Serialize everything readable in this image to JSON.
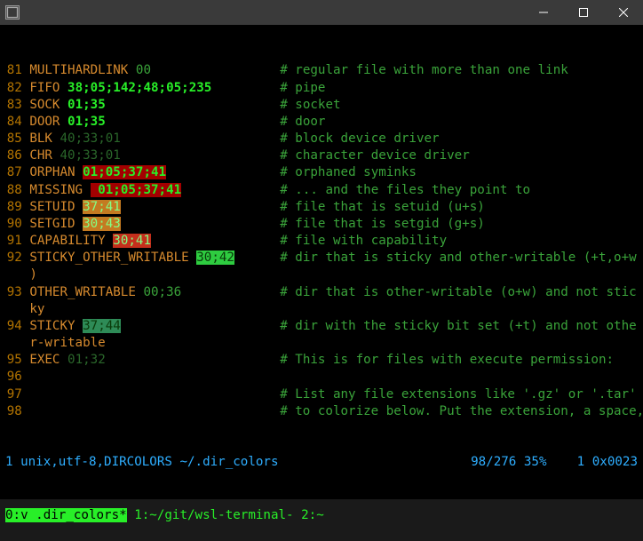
{
  "window": {
    "title": ""
  },
  "lines": [
    {
      "n": "81",
      "key": "MULTIHARDLINK",
      "val": "00",
      "cls": "",
      "c": "# regular file with more than one link"
    },
    {
      "n": "82",
      "key": "FIFO",
      "val": "38;05;142;48;05;235",
      "cls": "key-bold",
      "c": "# pipe"
    },
    {
      "n": "83",
      "key": "SOCK",
      "val": "01;35",
      "cls": "key-bold",
      "c": "# socket"
    },
    {
      "n": "84",
      "key": "DOOR",
      "val": "01;35",
      "cls": "key-bold",
      "c": "# door"
    },
    {
      "n": "85",
      "key": "BLK",
      "val": "40;33;01",
      "cls": "key-dim",
      "c": "# block device driver"
    },
    {
      "n": "86",
      "key": "CHR",
      "val": "40;33;01",
      "cls": "key-dim",
      "c": "# character device driver"
    },
    {
      "n": "87",
      "key": "ORPHAN",
      "val": "01;05;37;41",
      "cls": "hl-red",
      "c": "# orphaned syminks"
    },
    {
      "n": "88",
      "key": "MISSING",
      "val": " 01;05;37;41",
      "cls": "hl-red",
      "c": "# ... and the files they point to"
    },
    {
      "n": "89",
      "key": "SETUID",
      "val": "37;41",
      "cls": "hl-org",
      "c": "# file that is setuid (u+s)"
    },
    {
      "n": "90",
      "key": "SETGID",
      "val": "30;43",
      "cls": "hl-org",
      "c": "# file that is setgid (g+s)"
    },
    {
      "n": "91",
      "key": "CAPABILITY",
      "val": "30;41",
      "cls": "hl-org2",
      "c": "# file with capability"
    },
    {
      "n": "92",
      "key": "STICKY_OTHER_WRITABLE",
      "val": "30;42",
      "cls": "hl-grn",
      "c": "# dir that is sticky and other-writable (+t,o+w",
      "wrap": ")"
    },
    {
      "n": "93",
      "key": "OTHER_WRITABLE",
      "val": "00;36",
      "cls": "",
      "c": "# dir that is other-writable (o+w) and not stic",
      "wrap": "ky"
    },
    {
      "n": "94",
      "key": "STICKY",
      "val": "37;44",
      "cls": "hl-teal",
      "c": "# dir with the sticky bit set (+t) and not othe",
      "wrap": "r-writable"
    },
    {
      "n": "95",
      "key": "EXEC",
      "val": "01;32",
      "cls": "key-dim",
      "c": "# This is for files with execute permission:"
    },
    {
      "n": "96",
      "key": "",
      "val": "",
      "cls": "",
      "c": ""
    },
    {
      "n": "97",
      "key": "",
      "val": "",
      "cls": "",
      "c": "# List any file extensions like '.gz' or '.tar' that you would like ls"
    },
    {
      "n": "98",
      "key": "",
      "val": "",
      "cls": "",
      "c": "# to colorize below. Put the extension, a space, and the color init string."
    }
  ],
  "status1": {
    "left": "1 unix,utf-8,DIRCOLORS ~/.dir_colors",
    "right": "98/276 35%    1 0x0023"
  },
  "status2": {
    "active": "0:v .dir_colors*",
    "rest": " 1:~/git/wsl-terminal- 2:~"
  },
  "comment_col": 33
}
